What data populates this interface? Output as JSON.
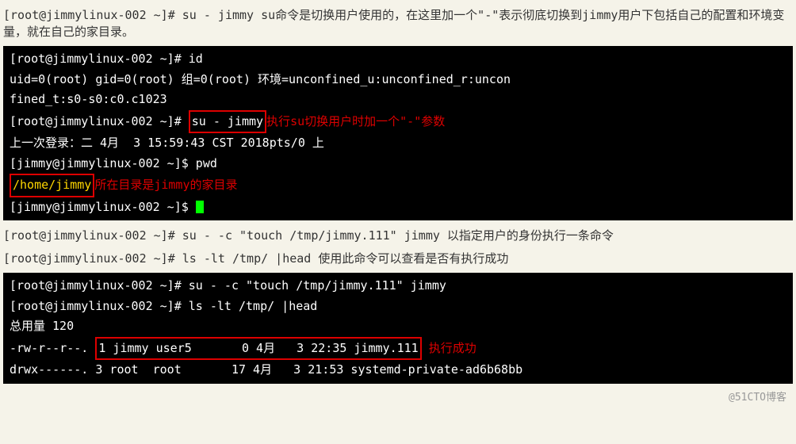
{
  "line1_prompt": "[root@jimmylinux-002 ~]# su - jimmy",
  "line1_note": "    su命令是切换用户使用的，在这里加一个\"-\"表示彻底切换到jimmy用户下包括自己的配置和环境变量，就在自己的家目录。",
  "t1": {
    "r1": "[root@jimmylinux-002 ~]# id",
    "r2": "uid=0(root) gid=0(root) 组=0(root) 环境=unconfined_u:unconfined_r:uncon",
    "r3": "fined_t:s0-s0:c0.c1023",
    "r4a": "[root@jimmylinux-002 ~]# ",
    "r4b": "su - jimmy",
    "r4n": "执行su切换用户时加一个\"-\"参数",
    "r5": "上一次登录：二 4月  3 15:59:43 CST 2018pts/0 上",
    "r6": "[jimmy@jimmylinux-002 ~]$ pwd",
    "r7a": "/home/jimmy",
    "r7n": "所在目录是jimmy的家目录",
    "r8": "[jimmy@jimmylinux-002 ~]$ "
  },
  "line2_prompt": "[root@jimmylinux-002 ~]# su - -c \"touch /tmp/jimmy.111\" jimmy",
  "line2_note": "    以指定用户的身份执行一条命令",
  "line3_prompt": "[root@jimmylinux-002 ~]# ls -lt /tmp/ |head",
  "line3_note": "    使用此命令可以查看是否有执行成功",
  "t2": {
    "r1": "[root@jimmylinux-002 ~]# su - -c \"touch /tmp/jimmy.111\" jimmy",
    "r2": "[root@jimmylinux-002 ~]# ls -lt /tmp/ |head",
    "r3": "总用量 120",
    "r4a": "-rw-r--r--. ",
    "r4b": "1 jimmy user5       0 4月   3 22:35 jimmy.111",
    "r4n": " 执行成功",
    "r5": "drwx------. 3 root  root       17 4月   3 21:53 systemd-private-ad6b68bb"
  },
  "watermark": "@51CTO博客"
}
